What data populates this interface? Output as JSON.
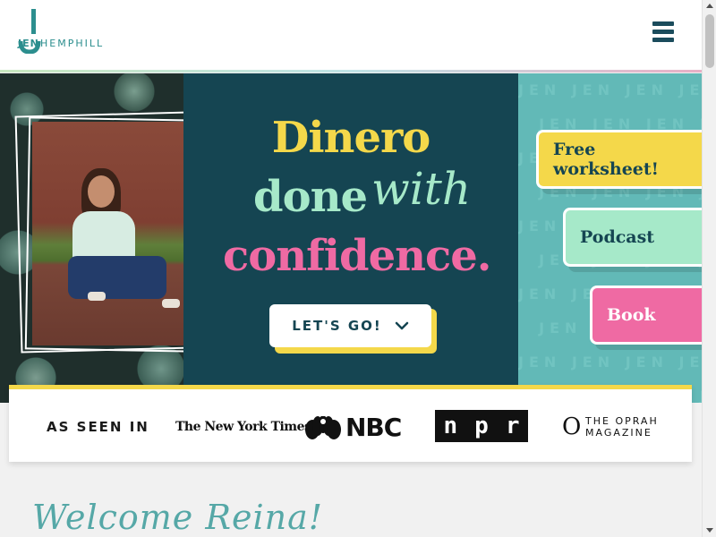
{
  "brand": {
    "logo_jen": "JEN",
    "logo_hemphill": "HEMPHILL",
    "menu_icon": "hamburger-menu-icon"
  },
  "hero": {
    "line1": "Dinero",
    "line2": "done",
    "line2_script": "with",
    "line3": "confidence.",
    "cta_label": "LET'S GO!",
    "cta_icon": "chevron-down-icon",
    "pattern_text": "JEN",
    "side_buttons": [
      {
        "label": "Free worksheet!"
      },
      {
        "label": "Podcast"
      },
      {
        "label": "Book"
      }
    ]
  },
  "as_seen_in": {
    "label": "AS SEEN IN",
    "nyt": "The New York Times",
    "nbc": "NBC",
    "npr": [
      "n",
      "p",
      "r"
    ],
    "oprah_o": "O",
    "oprah_line1": "THE OPRAH",
    "oprah_line2": "MAGAZINE"
  },
  "welcome": {
    "script": "Welcome Reina!"
  },
  "colors": {
    "teal_dark": "#154552",
    "yellow": "#f4d84a",
    "mint": "#a6e9c9",
    "pink": "#ef6aa3",
    "teal_light": "#62b9b7"
  }
}
